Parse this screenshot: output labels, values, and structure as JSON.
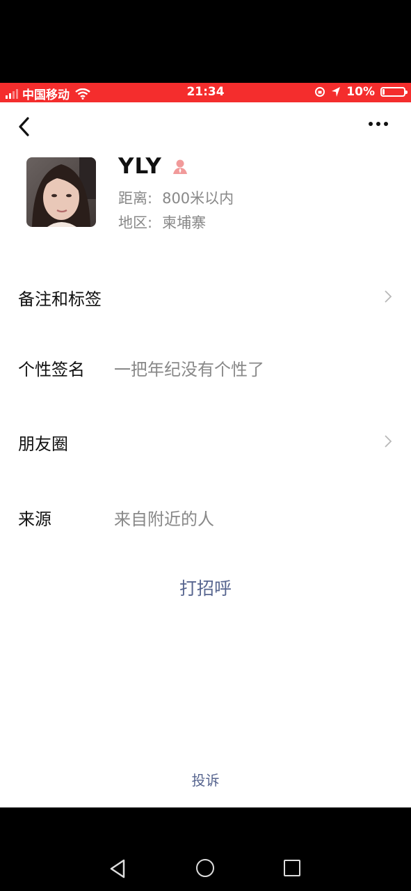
{
  "status_bar": {
    "carrier": "中国移动",
    "time": "21:34",
    "battery": "10%",
    "battery_level": 0.1,
    "accent_color": "#f42d2d"
  },
  "header": {
    "back_icon": "chevron-left-icon",
    "more_icon": "more-dots-icon"
  },
  "profile": {
    "name": "YLY",
    "gender_icon": "female-person-icon",
    "distance_label": "距离:",
    "distance_value": "800米以内",
    "region_label": "地区:",
    "region_value": "柬埔寨"
  },
  "rows": {
    "remarks_label": "备注和标签",
    "signature_label": "个性签名",
    "signature_value": "一把年纪没有个性了",
    "moments_label": "朋友圈",
    "source_label": "来源",
    "source_value": "来自附近的人"
  },
  "actions": {
    "greet": "打招呼",
    "report": "投诉",
    "link_color": "#57658f"
  },
  "android_nav": {
    "back_icon": "triangle-back-icon",
    "home_icon": "circle-home-icon",
    "recent_icon": "square-recent-icon"
  }
}
